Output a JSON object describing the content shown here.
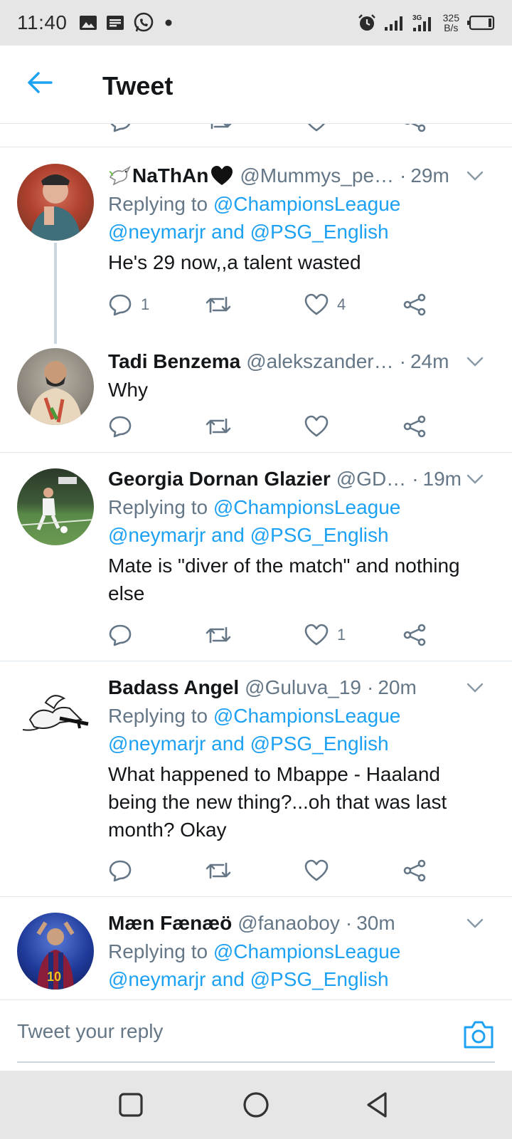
{
  "status_bar": {
    "time": "11:40",
    "net_speed_value": "325",
    "net_speed_unit": "B/s",
    "icons": [
      "image-icon",
      "message-icon",
      "whatsapp-icon",
      "dot-icon",
      "alarm-icon",
      "signal-icon",
      "signal-3g-icon",
      "battery-icon"
    ]
  },
  "header": {
    "title": "Tweet"
  },
  "tweets": [
    {
      "display_name": "NaThAn",
      "handle": "@Mummys_pe…",
      "time": "29m",
      "replying_to": "Replying to",
      "mention1": "@ChampionsLeague",
      "mention2": "@neymarjr",
      "and": "and",
      "mention3": "@PSG_English",
      "text": "He's 29 now,,a talent wasted",
      "reply_count": "1",
      "retweet_count": "",
      "like_count": "4"
    },
    {
      "display_name": "Tadi Benzema",
      "handle": "@alekszander…",
      "time": "24m",
      "text": "Why",
      "reply_count": "",
      "retweet_count": "",
      "like_count": ""
    },
    {
      "display_name": "Georgia Dornan Glazier",
      "handle": "@GD…",
      "time": "19m",
      "replying_to": "Replying to",
      "mention1": "@ChampionsLeague",
      "mention2": "@neymarjr",
      "and": "and",
      "mention3": "@PSG_English",
      "text_line1": "Mate is \"diver of the match\" and nothing",
      "text_line2": "else",
      "reply_count": "",
      "retweet_count": "",
      "like_count": "1"
    },
    {
      "display_name": "Badass Angel",
      "handle": "@Guluva_19",
      "time": "20m",
      "replying_to": "Replying to",
      "mention1": "@ChampionsLeague",
      "mention2": "@neymarjr",
      "and": "and",
      "mention3": "@PSG_English",
      "text_line1": "What happened to Mbappe - Haaland",
      "text_line2": "being the new thing?...oh that was last",
      "text_line3": "month? Okay",
      "reply_count": "",
      "retweet_count": "",
      "like_count": ""
    },
    {
      "display_name": "Mæn Fænæö",
      "handle": "@fanaoboy",
      "time": "30m",
      "replying_to": "Replying to",
      "mention1": "@ChampionsLeague",
      "mention2": "@neymarjr",
      "and": "and",
      "mention3": "@PSG_English"
    }
  ],
  "reply_bar": {
    "placeholder": "Tweet your reply"
  },
  "colors": {
    "accent": "#1da1f2",
    "secondary_text": "#657786",
    "primary_text": "#14171a",
    "divider": "#e1e8ed"
  },
  "nav_bar": {
    "buttons": [
      "recents-square-icon",
      "home-circle-icon",
      "back-triangle-icon"
    ]
  }
}
